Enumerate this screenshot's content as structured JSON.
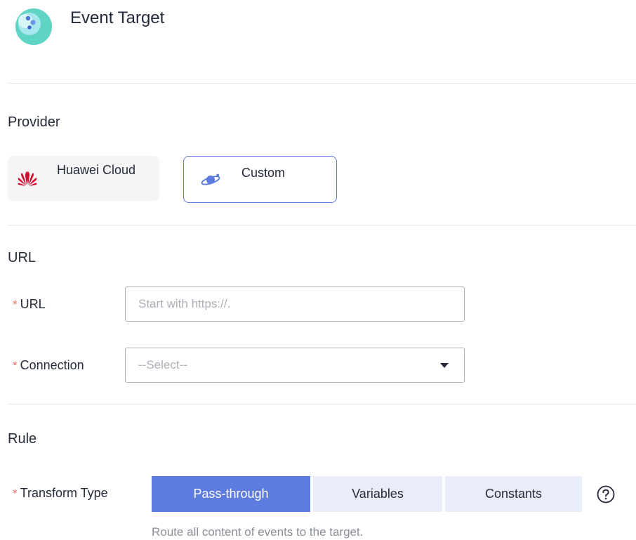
{
  "header": {
    "title": "Event Target",
    "icon": "event-target-logo-icon"
  },
  "provider": {
    "title": "Provider",
    "options": [
      {
        "label": "Huawei Cloud",
        "icon": "huawei-logo-icon",
        "selected": false
      },
      {
        "label": "Custom",
        "icon": "planet-icon",
        "selected": true
      }
    ]
  },
  "url_section": {
    "title": "URL",
    "url_field": {
      "label": "URL",
      "required_mark": "*",
      "value": "",
      "placeholder": "Start with https://."
    },
    "connection_field": {
      "label": "Connection",
      "required_mark": "*",
      "value": "--Select--"
    }
  },
  "rule": {
    "title": "Rule",
    "transform_type": {
      "label": "Transform Type",
      "required_mark": "*",
      "options": [
        "Pass-through",
        "Variables",
        "Constants"
      ],
      "selected": "Pass-through",
      "hint": "Route all content of events to the target."
    }
  },
  "colors": {
    "accent": "#5e7ce0",
    "segment_inactive_bg": "#e9edfa",
    "required": "#f66f6a",
    "divider": "#e3e5ea",
    "huawei_red": "#cf0a2c"
  }
}
